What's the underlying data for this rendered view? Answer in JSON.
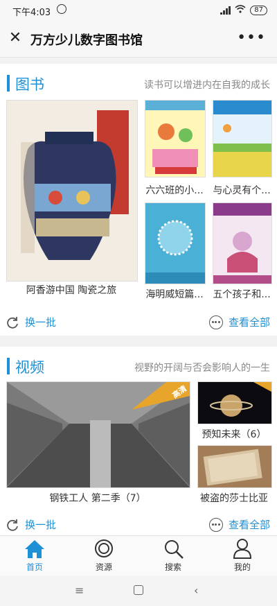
{
  "status": {
    "time": "下午4:03",
    "battery": "87"
  },
  "app": {
    "title": "万方少儿数字图书馆"
  },
  "books": {
    "title": "图书",
    "subtitle": "读书可以增进内在自我的成长",
    "items": [
      {
        "title": "阿香游中国 陶瓷之旅"
      },
      {
        "title": "六六班的小..."
      },
      {
        "title": "与心灵有个..."
      },
      {
        "title": "海明威短篇..."
      },
      {
        "title": "五个孩子和..."
      }
    ],
    "refresh_label": "换一批",
    "view_all_label": "查看全部"
  },
  "videos": {
    "title": "视频",
    "subtitle": "视野的开阔与否会影响人的一生",
    "items": [
      {
        "title": "钢铁工人 第二季（7）",
        "badge": "高清"
      },
      {
        "title": "预知未来（6）",
        "badge": "高清"
      },
      {
        "title": "被盗的莎士比亚"
      }
    ],
    "refresh_label": "换一批",
    "view_all_label": "查看全部"
  },
  "tabs": [
    {
      "label": "首页",
      "icon": "home-icon",
      "active": true
    },
    {
      "label": "资源",
      "icon": "resource-icon"
    },
    {
      "label": "搜索",
      "icon": "search-icon"
    },
    {
      "label": "我的",
      "icon": "user-icon"
    }
  ],
  "colors": {
    "accent": "#1e90d6"
  }
}
